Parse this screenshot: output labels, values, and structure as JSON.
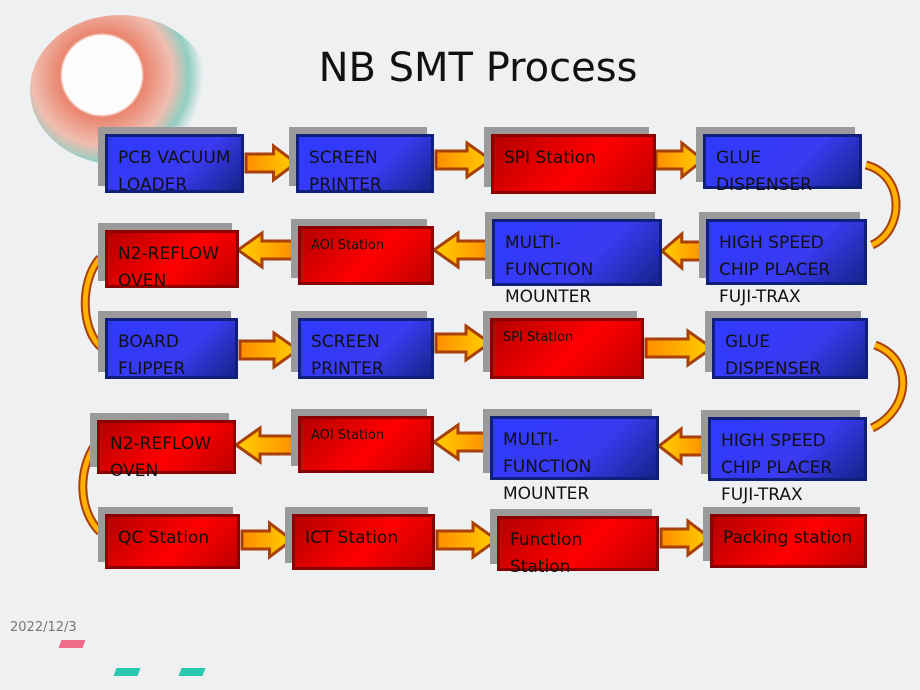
{
  "title": "NB SMT Process",
  "date": "2022/12/3",
  "steps": {
    "r1": [
      "PCB VACUUM LOADER",
      "SCREEN PRINTER",
      "SPI Station",
      "GLUE DISPENSER"
    ],
    "r2": [
      "N2-REFLOW OVEN",
      "AOI Station",
      "MULTI-FUNCTION MOUNTER",
      "HIGH SPEED CHIP PLACER FUJI-TRAX"
    ],
    "r3": [
      "BOARD FLIPPER",
      "SCREEN PRINTER",
      "SPI Station",
      "GLUE DISPENSER"
    ],
    "r4": [
      "N2-REFLOW OVEN",
      "AOI Station",
      "MULTI-FUNCTION MOUNTER",
      "HIGH SPEED CHIP PLACER FUJI-TRAX"
    ],
    "r5": [
      "QC Station",
      "ICT Station",
      "Function Station",
      "Packing station"
    ]
  },
  "colors": {
    "machine": "#3333ff",
    "station": "#ff0000",
    "arrow": "#ffb000"
  }
}
